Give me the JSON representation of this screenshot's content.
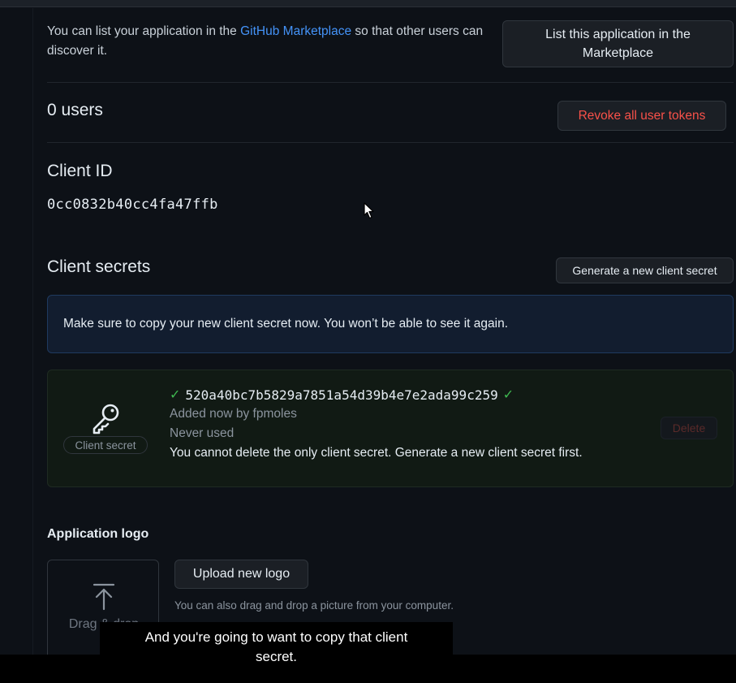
{
  "marketplace": {
    "text_before": "You can list your application in the ",
    "link": "GitHub Marketplace",
    "text_after": " so that other users can discover it.",
    "button": "List this application in the Marketplace"
  },
  "users": {
    "heading": "0 users",
    "revoke_button": "Revoke all user tokens"
  },
  "client_id": {
    "heading": "Client ID",
    "value": "0cc0832b40cc4fa47ffb"
  },
  "client_secrets": {
    "heading": "Client secrets",
    "generate_button": "Generate a new client secret",
    "flash": "Make sure to copy your new client secret now. You won’t be able to see it again.",
    "secret": {
      "label": "Client secret",
      "value": "520a40bc7b5829a7851a54d39b4e7e2ada99c259",
      "added": "Added now by fpmoles",
      "usage": "Never used",
      "note": "You cannot delete the only client secret. Generate a new client secret first.",
      "delete_button": "Delete"
    }
  },
  "application_logo": {
    "heading": "Application logo",
    "dropzone": "Drag & drop",
    "upload_button": "Upload new logo",
    "hint": "You can also drag and drop a picture from your computer."
  },
  "caption": {
    "line1": "And you're going to want to copy that client",
    "line2": "secret."
  },
  "colors": {
    "background": "#0d1117",
    "link": "#4493f8",
    "danger": "#f85149",
    "success": "#3fb950"
  }
}
